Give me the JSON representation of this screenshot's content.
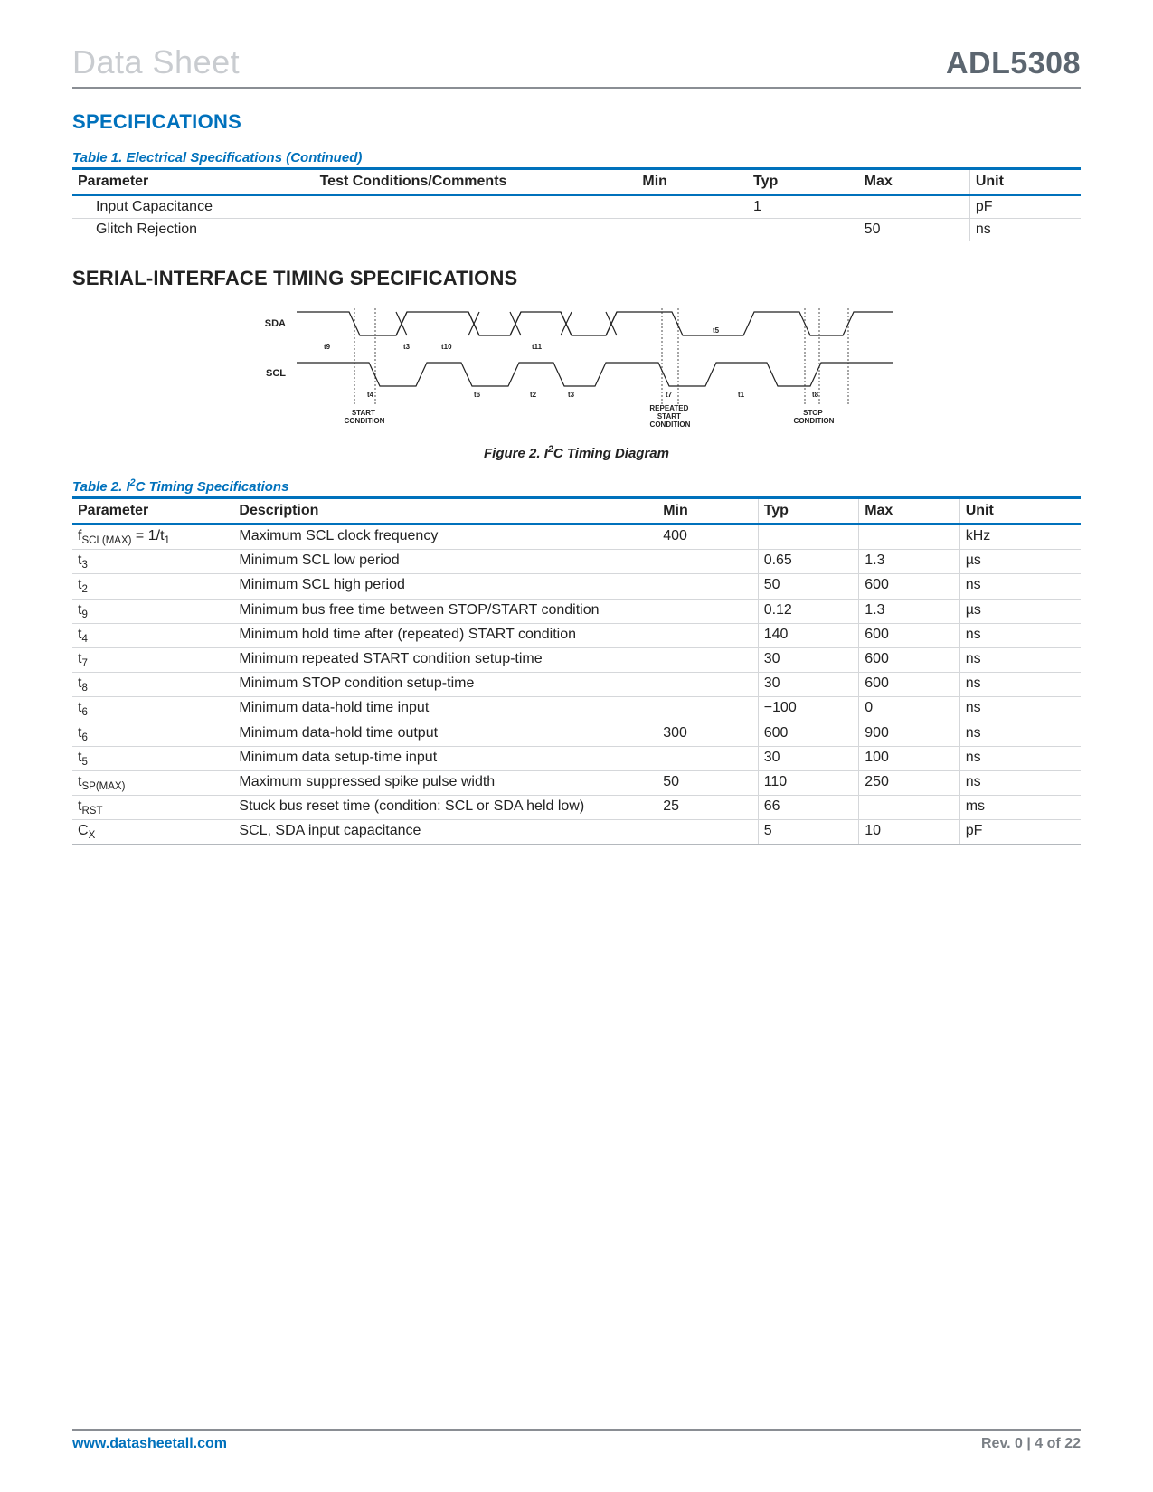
{
  "header": {
    "left": "Data Sheet",
    "right": "ADL5308"
  },
  "section_title": "SPECIFICATIONS",
  "table1": {
    "caption": "Table 1. Electrical Specifications (Continued)",
    "headers": [
      "Parameter",
      "Test Conditions/Comments",
      "Min",
      "Typ",
      "Max",
      "Unit"
    ],
    "rows": [
      {
        "parameter": "Input Capacitance",
        "conditions": "",
        "min": "",
        "typ": "1",
        "max": "",
        "unit": "pF"
      },
      {
        "parameter": "Glitch Rejection",
        "conditions": "",
        "min": "",
        "typ": "",
        "max": "50",
        "unit": "ns"
      }
    ]
  },
  "subsection": "SERIAL-INTERFACE TIMING SPECIFICATIONS",
  "figure": {
    "caption": "Figure 2. I²C Timing Diagram",
    "labels": {
      "sda": "SDA",
      "scl": "SCL",
      "start": "START\nCONDITION",
      "repeated": "REPEATED\nSTART\nCONDITION",
      "stop": "STOP\nCONDITION",
      "t1": "t1",
      "t2": "t2",
      "t3": "t3",
      "t4": "t4",
      "t5": "t5",
      "t6": "t6",
      "t7": "t7",
      "t8": "t8",
      "t9": "t9",
      "t10": "t10",
      "t11": "t11"
    }
  },
  "table2": {
    "caption": "Table 2. I²C Timing Specifications",
    "headers": [
      "Parameter",
      "Description",
      "Min",
      "Typ",
      "Max",
      "Unit"
    ],
    "rows": [
      {
        "parameter_html": "f<sub>SCL(MAX)</sub> = 1/t<sub>1</sub>",
        "description": "Maximum SCL clock frequency",
        "min": "400",
        "typ": "",
        "max": "",
        "unit": "kHz"
      },
      {
        "parameter_html": "t<sub>3</sub>",
        "description": "Minimum SCL low period",
        "min": "",
        "typ": "0.65",
        "max": "1.3",
        "unit": "µs"
      },
      {
        "parameter_html": "t<sub>2</sub>",
        "description": "Minimum SCL high period",
        "min": "",
        "typ": "50",
        "max": "600",
        "unit": "ns"
      },
      {
        "parameter_html": "t<sub>9</sub>",
        "description": "Minimum bus free time between STOP/START condition",
        "min": "",
        "typ": "0.12",
        "max": "1.3",
        "unit": "µs"
      },
      {
        "parameter_html": "t<sub>4</sub>",
        "description": "Minimum hold time after (repeated) START condition",
        "min": "",
        "typ": "140",
        "max": "600",
        "unit": "ns"
      },
      {
        "parameter_html": "t<sub>7</sub>",
        "description": "Minimum repeated START condition setup-time",
        "min": "",
        "typ": "30",
        "max": "600",
        "unit": "ns"
      },
      {
        "parameter_html": "t<sub>8</sub>",
        "description": "Minimum STOP condition setup-time",
        "min": "",
        "typ": "30",
        "max": "600",
        "unit": "ns"
      },
      {
        "parameter_html": "t<sub>6</sub>",
        "description": "Minimum data-hold time input",
        "min": "",
        "typ": "−100",
        "max": "0",
        "unit": "ns"
      },
      {
        "parameter_html": "t<sub>6</sub>",
        "description": "Minimum data-hold time output",
        "min": "300",
        "typ": "600",
        "max": "900",
        "unit": "ns"
      },
      {
        "parameter_html": "t<sub>5</sub>",
        "description": "Minimum data setup-time input",
        "min": "",
        "typ": "30",
        "max": "100",
        "unit": "ns"
      },
      {
        "parameter_html": "t<sub>SP(MAX)</sub>",
        "description": "Maximum suppressed spike pulse width",
        "min": "50",
        "typ": "110",
        "max": "250",
        "unit": "ns"
      },
      {
        "parameter_html": "t<sub>RST</sub>",
        "description": "Stuck bus reset time (condition: SCL or SDA held low)",
        "min": "25",
        "typ": "66",
        "max": "",
        "unit": "ms"
      },
      {
        "parameter_html": "C<sub>X</sub>",
        "description": "SCL, SDA input capacitance",
        "min": "",
        "typ": "5",
        "max": "10",
        "unit": "pF"
      }
    ]
  },
  "footer": {
    "left": "www.datasheetall.com",
    "right": "Rev. 0 | 4 of 22"
  }
}
